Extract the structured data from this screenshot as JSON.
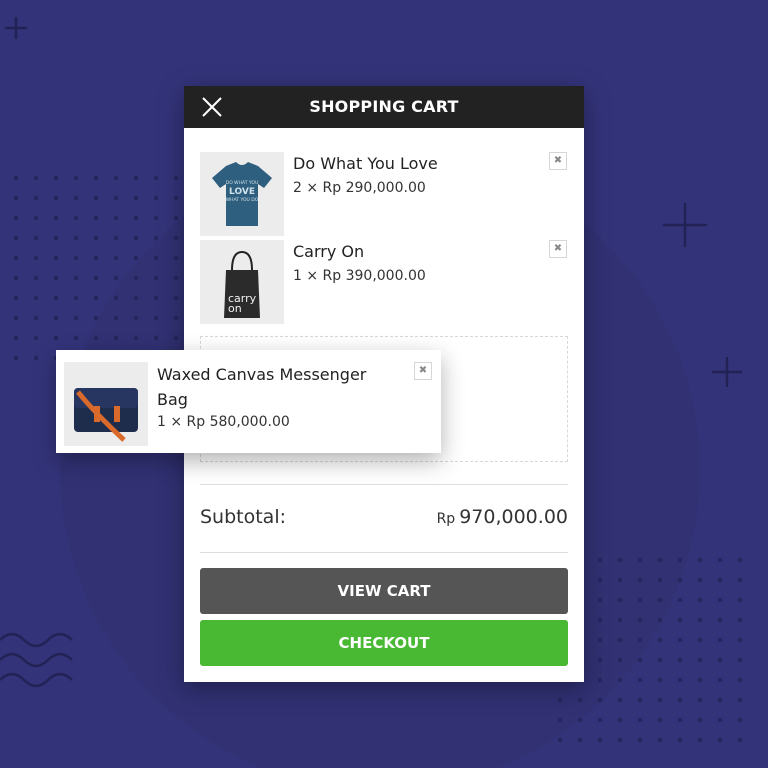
{
  "cart": {
    "title": "SHOPPING CART",
    "items": [
      {
        "name": "Do What You Love",
        "qty_price": "2 ×  Rp 290,000.00",
        "image": "blue-tshirt",
        "shirt_text": "DO WHAT YOU LOVE WHAT YOU DO"
      },
      {
        "name": "Carry On",
        "qty_price": "1 ×  Rp 390,000.00",
        "image": "tote-bag",
        "bag_text": "carry on"
      }
    ],
    "dragged_item": {
      "name": "Waxed Canvas Messenger Bag",
      "qty_price": "1 ×  Rp 580,000.00",
      "image": "messenger-bag"
    },
    "subtotal_label": "Subtotal:",
    "subtotal_currency": "Rp",
    "subtotal_amount": "970,000.00",
    "view_cart_label": "VIEW CART",
    "checkout_label": "CHECKOUT",
    "remove_symbol": "✖"
  },
  "colors": {
    "background": "#33337a",
    "header": "#222222",
    "view_cart": "#555555",
    "checkout": "#49b934"
  }
}
